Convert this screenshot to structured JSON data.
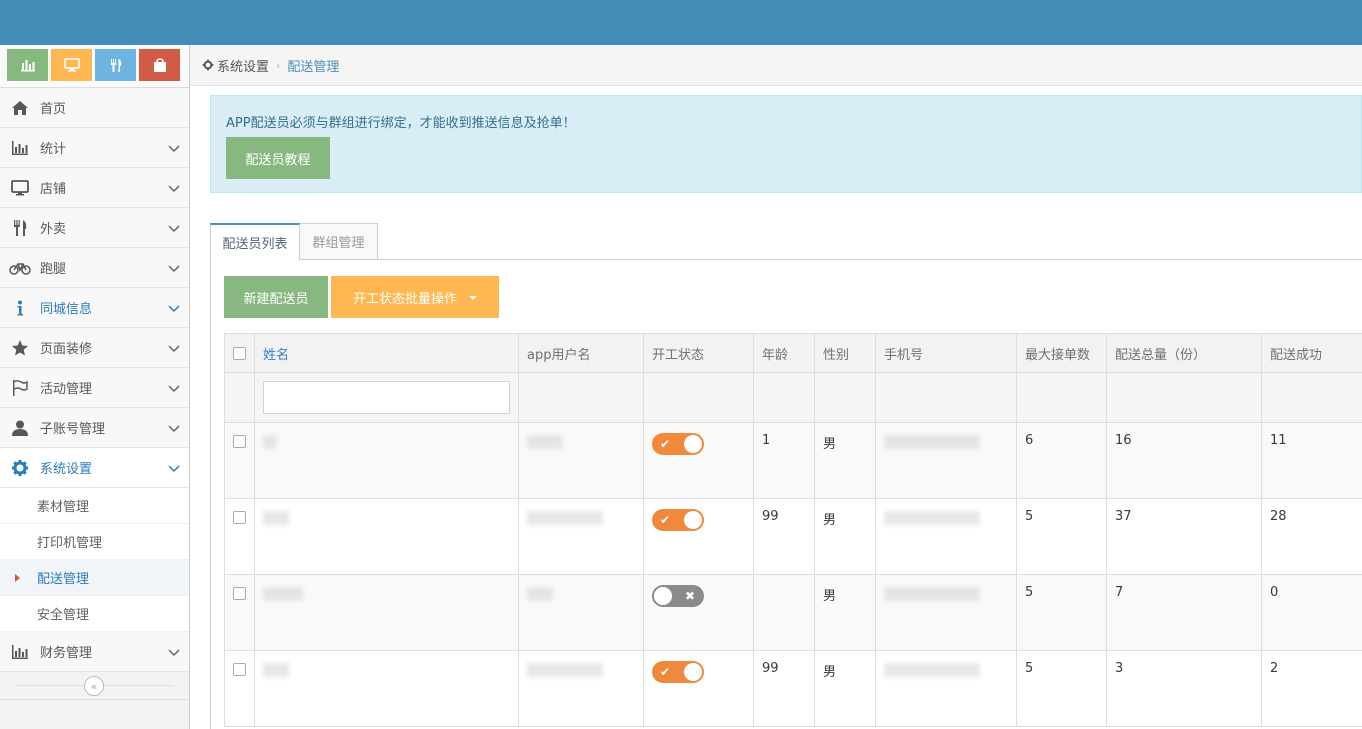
{
  "colors": {
    "navbar": "#438eb9",
    "success": "#87b87f",
    "warning": "#ffb752",
    "toggle_on": "#f0893c",
    "toggle_off": "#8b8b8b",
    "link": "#2b7dbc"
  },
  "shortcuts": [
    {
      "icon": "bar-chart-icon",
      "color": "#87b87f"
    },
    {
      "icon": "desktop-icon",
      "color": "#ffb752"
    },
    {
      "icon": "cutlery-icon",
      "color": "#6fb3e0"
    },
    {
      "icon": "shopping-bag-icon",
      "color": "#d15b47"
    }
  ],
  "sidebar": {
    "items": [
      {
        "label": "首页",
        "icon": "home-icon"
      },
      {
        "label": "统计",
        "icon": "bar-chart-icon"
      },
      {
        "label": "店铺",
        "icon": "desktop-icon"
      },
      {
        "label": "外卖",
        "icon": "cutlery-icon"
      },
      {
        "label": "跑腿",
        "icon": "bicycle-icon"
      },
      {
        "label": "同城信息",
        "icon": "info-icon"
      },
      {
        "label": "页面装修",
        "icon": "star-icon"
      },
      {
        "label": "活动管理",
        "icon": "flag-icon"
      },
      {
        "label": "子账号管理",
        "icon": "user-icon"
      },
      {
        "label": "系统设置",
        "icon": "cog-icon"
      },
      {
        "label": "财务管理",
        "icon": "bar-chart-icon"
      }
    ],
    "sub_items": [
      {
        "label": "素材管理"
      },
      {
        "label": "打印机管理"
      },
      {
        "label": "配送管理"
      },
      {
        "label": "安全管理"
      }
    ],
    "collapse_glyph": "«"
  },
  "breadcrumb": {
    "home": "系统设置",
    "sep": "›",
    "current": "配送管理"
  },
  "alert": {
    "message": "APP配送员必须与群组进行绑定，才能收到推送信息及抢单！",
    "button": "配送员教程"
  },
  "tabs": [
    {
      "label": "配送员列表"
    },
    {
      "label": "群组管理"
    }
  ],
  "toolbar": {
    "new_button": "新建配送员",
    "batch_button": "开工状态批量操作"
  },
  "table": {
    "headers": [
      "姓名",
      "app用户名",
      "开工状态",
      "年龄",
      "性别",
      "手机号",
      "最大接单数",
      "配送总量（份）",
      "配送成功"
    ],
    "name_filter_placeholder": "",
    "rows": [
      {
        "working": true,
        "working_mark": "✔",
        "age": "1",
        "gender": "男",
        "max_orders": "6",
        "total": "16",
        "success": "11"
      },
      {
        "working": true,
        "working_mark": "✔",
        "age": "99",
        "gender": "男",
        "max_orders": "5",
        "total": "37",
        "success": "28"
      },
      {
        "working": false,
        "working_mark": "✖",
        "age": "",
        "gender": "男",
        "max_orders": "5",
        "total": "7",
        "success": "0"
      },
      {
        "working": true,
        "working_mark": "✔",
        "age": "99",
        "gender": "男",
        "max_orders": "5",
        "total": "3",
        "success": "2"
      }
    ]
  }
}
